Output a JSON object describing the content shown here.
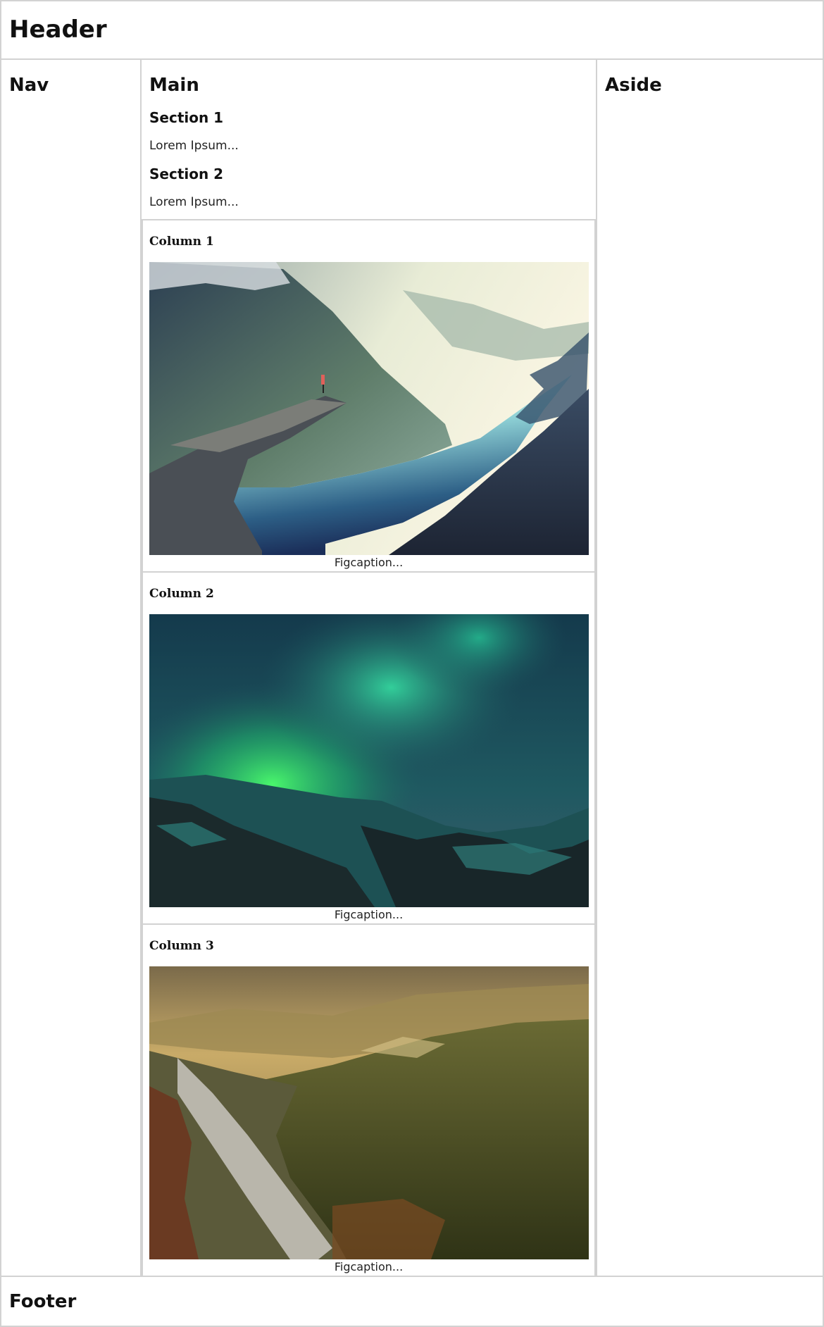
{
  "header": {
    "title": "Header"
  },
  "nav": {
    "title": "Nav"
  },
  "main": {
    "title": "Main",
    "sections": [
      {
        "heading": "Section 1",
        "text": "Lorem Ipsum..."
      },
      {
        "heading": "Section 2",
        "text": "Lorem Ipsum..."
      }
    ],
    "columns": [
      {
        "heading": "Column 1",
        "caption": "Figcaption...",
        "image": "fjord-cliff-photo"
      },
      {
        "heading": "Column 2",
        "caption": "Figcaption...",
        "image": "aurora-photo"
      },
      {
        "heading": "Column 3",
        "caption": "Figcaption...",
        "image": "forest-valley-photo"
      }
    ]
  },
  "aside": {
    "title": "Aside"
  },
  "footer": {
    "title": "Footer"
  }
}
